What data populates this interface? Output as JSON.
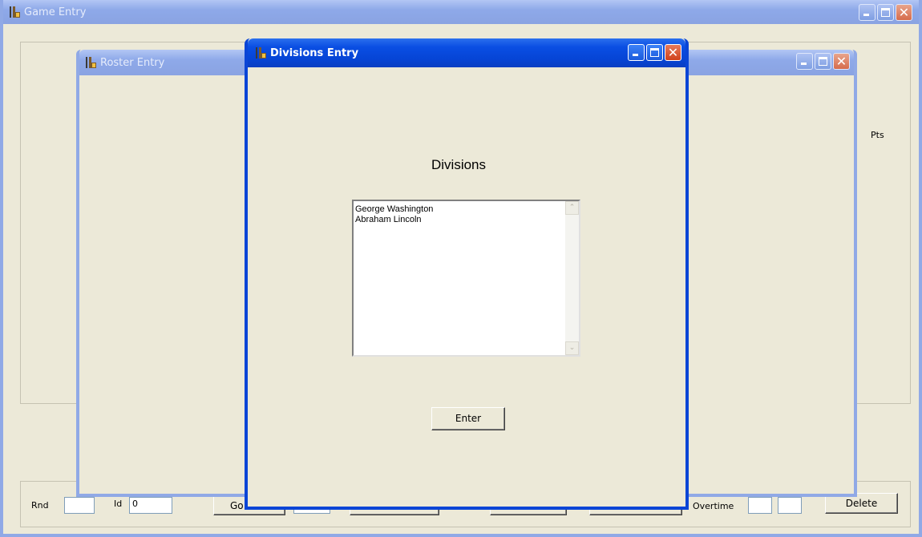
{
  "game_window": {
    "title": "Game Entry",
    "pts_label": "Pts",
    "bottom_bar": {
      "rnd_label": "Rnd",
      "rnd_value": "",
      "id_label": "Id",
      "id_value": "0",
      "go_button_partial": "Go",
      "overtime_label": "Overtime",
      "delete_button": "Delete"
    }
  },
  "roster_window": {
    "title": "Roster Entry"
  },
  "divisions_window": {
    "title": "Divisions Entry",
    "heading": "Divisions",
    "divisions": [
      "George Washington",
      "Abraham Lincoln"
    ],
    "enter_button": "Enter"
  },
  "colors": {
    "active_title": "#0a4ee3",
    "inactive_title": "#8ea9e9",
    "dialog_face": "#ece9d8",
    "close_button": "#d0411c"
  }
}
